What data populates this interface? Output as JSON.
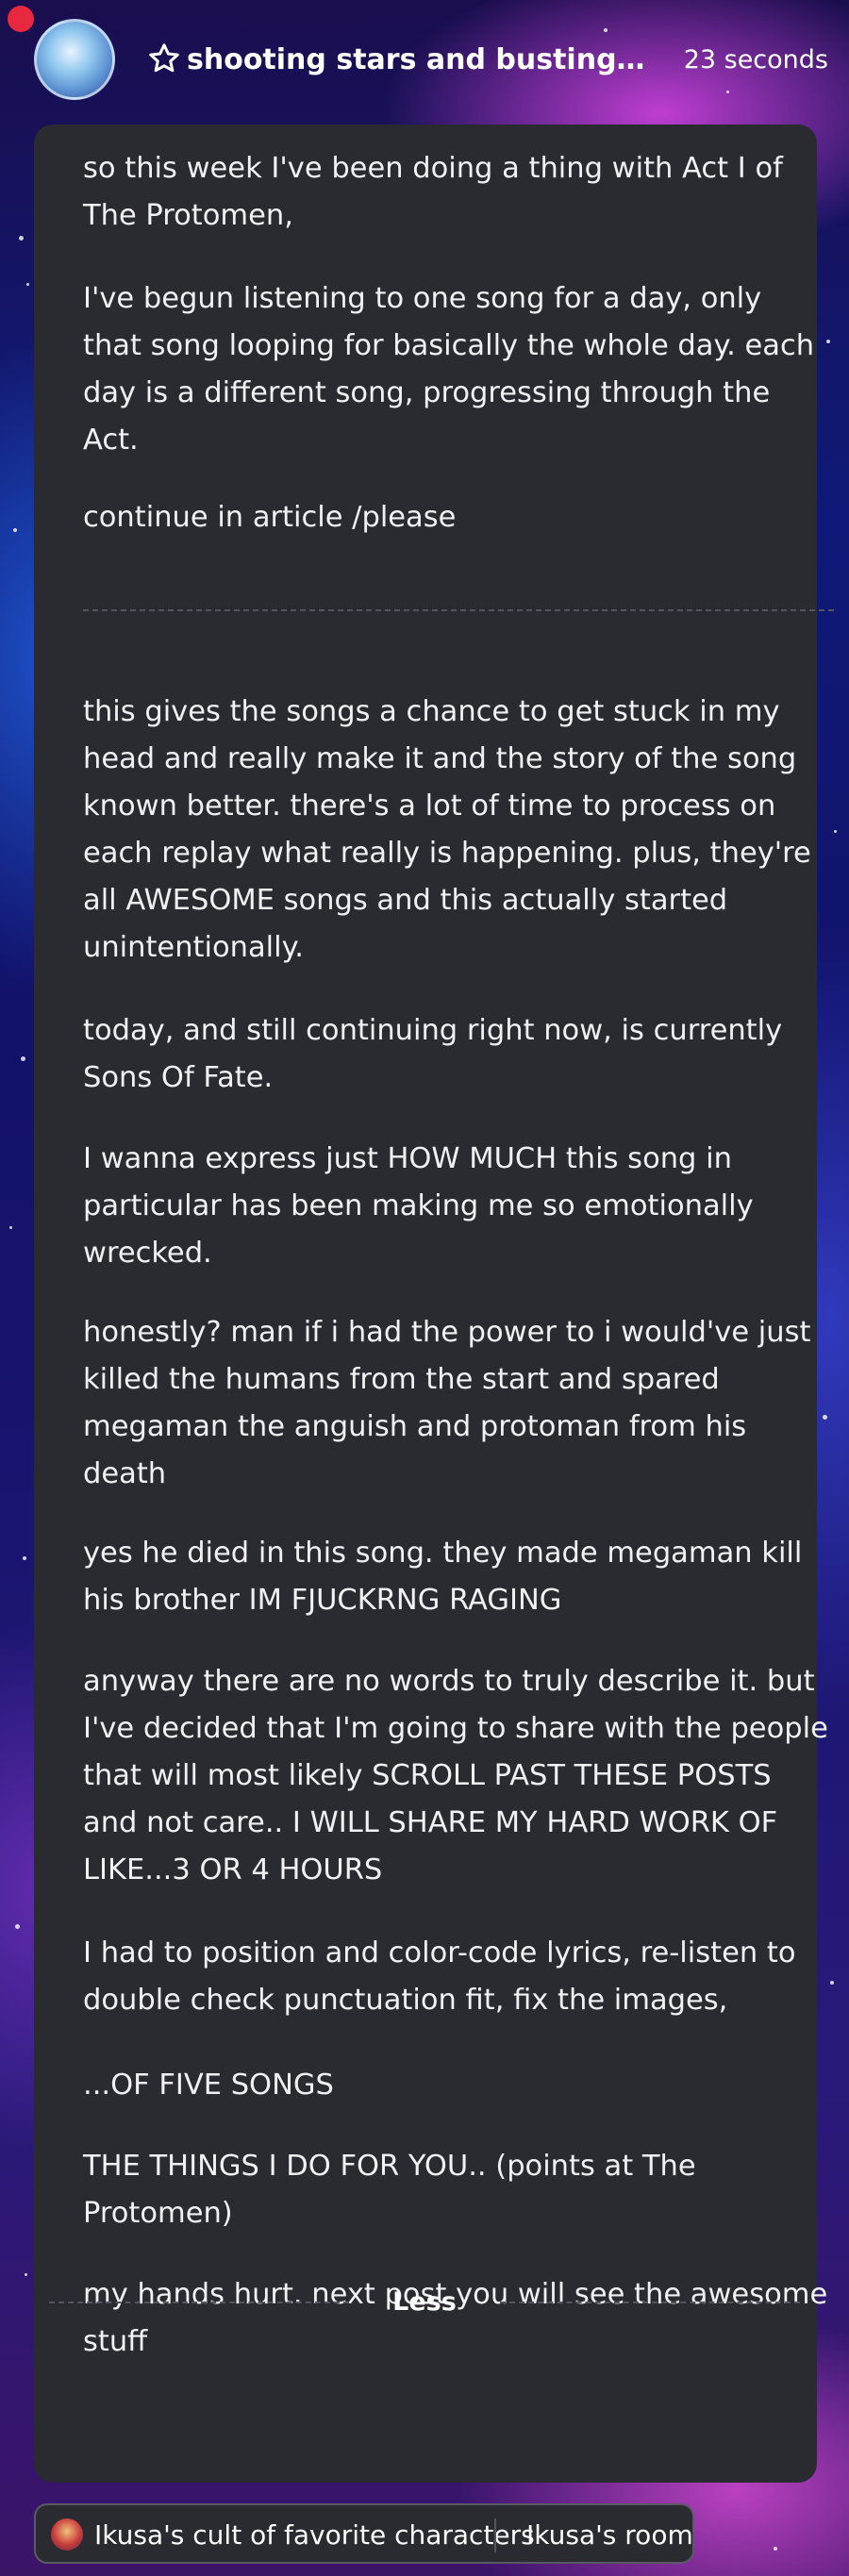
{
  "header": {
    "title": "shooting stars and busting vir...",
    "time_ago": "23 seconds",
    "title_icon": "star-outline-icon"
  },
  "post": {
    "paragraphs_top": [
      "so this week I've been doing a thing with Act I of The Protomen,",
      "I've begun listening to one song for a day, only that song looping for basically the whole day. each day is a different song, progressing through the Act.",
      "continue in article /please"
    ],
    "paragraphs_body": [
      "this gives the songs a chance to get stuck in my head and really make it and the story of the song known better. there's a lot of time to process on each replay what really is happening. plus, they're all AWESOME songs and this actually started unintentionally.",
      "today, and still continuing right now, is currently Sons Of Fate.",
      "I wanna express just HOW MUCH this song in particular has been making me so emotionally wrecked.",
      "honestly? man if i had the power to i would've just killed the humans from the start and spared megaman the anguish and protoman from his death",
      "yes he died in this song. they made megaman kill his brother IM FJUCKRNG RAGING",
      "anyway there are no words to truly describe it. but I've decided that I'm going to share with the people that will most likely SCROLL PAST THESE POSTS and not care.. I WILL SHARE MY HARD WORK OF LIKE...3 OR 4 HOURS",
      "I had to position and color-code lyrics, re-listen to double check punctuation fit, fix the images,",
      "...OF FIVE SONGS",
      "THE THINGS I DO FOR YOU.. (points at The Protomen)",
      "my hands hurt. next post you will see the awesome stuff"
    ],
    "less_label": "Less"
  },
  "footer": {
    "community_label": "Ikusa's cult of favorite characters",
    "room_label": "Ikusa's room",
    "community_icon": "community-avatar-icon"
  }
}
